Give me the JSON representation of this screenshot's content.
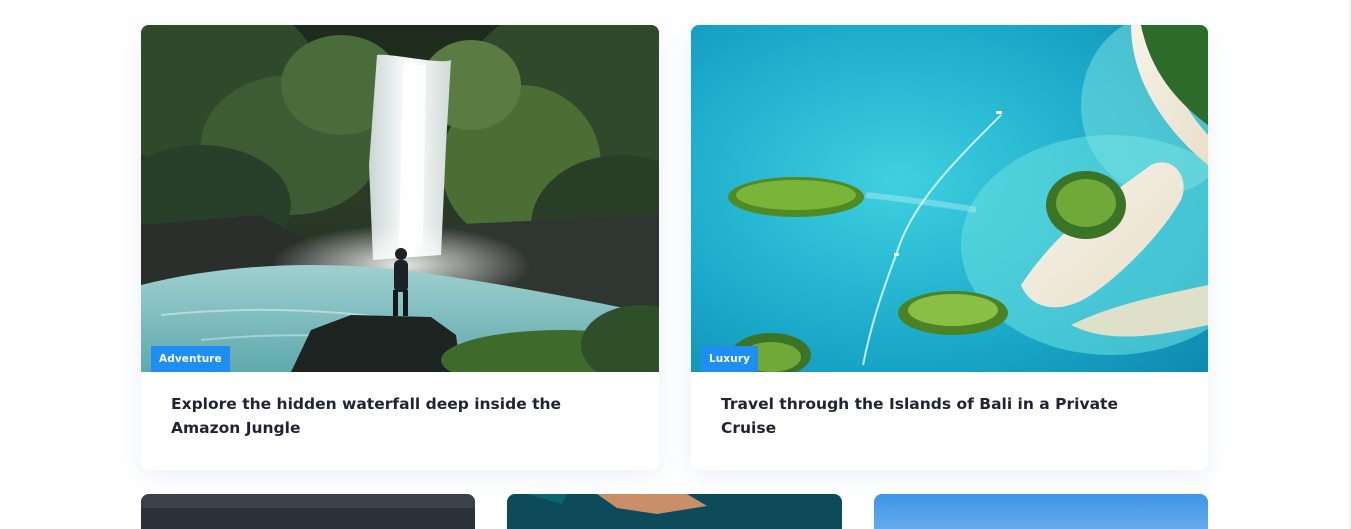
{
  "cards": [
    {
      "badge": "Adventure",
      "title": "Explore the hidden waterfall deep inside the Amazon Jungle",
      "image": "waterfall-photo"
    },
    {
      "badge": "Luxury",
      "title": "Travel through the Islands of Bali in a Private Cruise",
      "image": "islands-aerial-photo"
    }
  ],
  "more_cards": [
    "dark-coast-photo",
    "rocky-island-photo",
    "blue-sky-photo"
  ],
  "colors": {
    "badge": "#1e8ef0",
    "title": "#1f2433",
    "background": "#ffffff"
  }
}
